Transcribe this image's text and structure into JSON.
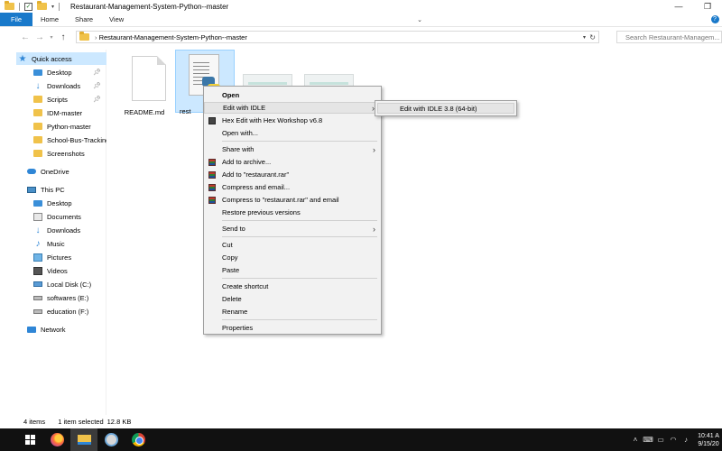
{
  "window": {
    "title": "Restaurant-Management-System-Python--master",
    "controls": [
      "—",
      "❐",
      "✕"
    ]
  },
  "ribbon": {
    "tabs": [
      "File",
      "Home",
      "Share",
      "View"
    ]
  },
  "address": {
    "path": "Restaurant-Management-System-Python--master",
    "search_placeholder": "Search Restaurant-Managem..."
  },
  "nav": {
    "quick_access": "Quick access",
    "quick_items": [
      "Desktop",
      "Downloads",
      "Scripts",
      "IDM-master",
      "Python-master",
      "School-Bus-Tracking",
      "Screenshots"
    ],
    "onedrive": "OneDrive",
    "this_pc": "This PC",
    "pc_items": [
      "Desktop",
      "Documents",
      "Downloads",
      "Music",
      "Pictures",
      "Videos",
      "Local Disk (C:)",
      "softwares (E:)",
      "education (F:)"
    ],
    "network": "Network"
  },
  "files": [
    {
      "name": "README.md",
      "icon": "document-icon"
    },
    {
      "name": "rest",
      "icon": "python-file-icon"
    }
  ],
  "context_menu": {
    "items": [
      "Open",
      "Edit with IDLE",
      "Hex Edit with Hex Workshop v6.8",
      "Open with...",
      "Share with",
      "Add to archive...",
      "Add to \"restaurant.rar\"",
      "Compress and email...",
      "Compress to \"restaurant.rar\" and email",
      "Restore previous versions",
      "Send to",
      "Cut",
      "Copy",
      "Paste",
      "Create shortcut",
      "Delete",
      "Rename",
      "Properties"
    ]
  },
  "submenu": {
    "item": "Edit with IDLE 3.8 (64-bit)"
  },
  "status": {
    "item_count": "4 items",
    "selection": "1 item selected",
    "size": "12.8 KB"
  },
  "taskbar": {
    "time": "10:41 A",
    "date": "9/15/20"
  },
  "colors": {
    "accent": "#1979ca",
    "selection": "#cce8ff"
  }
}
